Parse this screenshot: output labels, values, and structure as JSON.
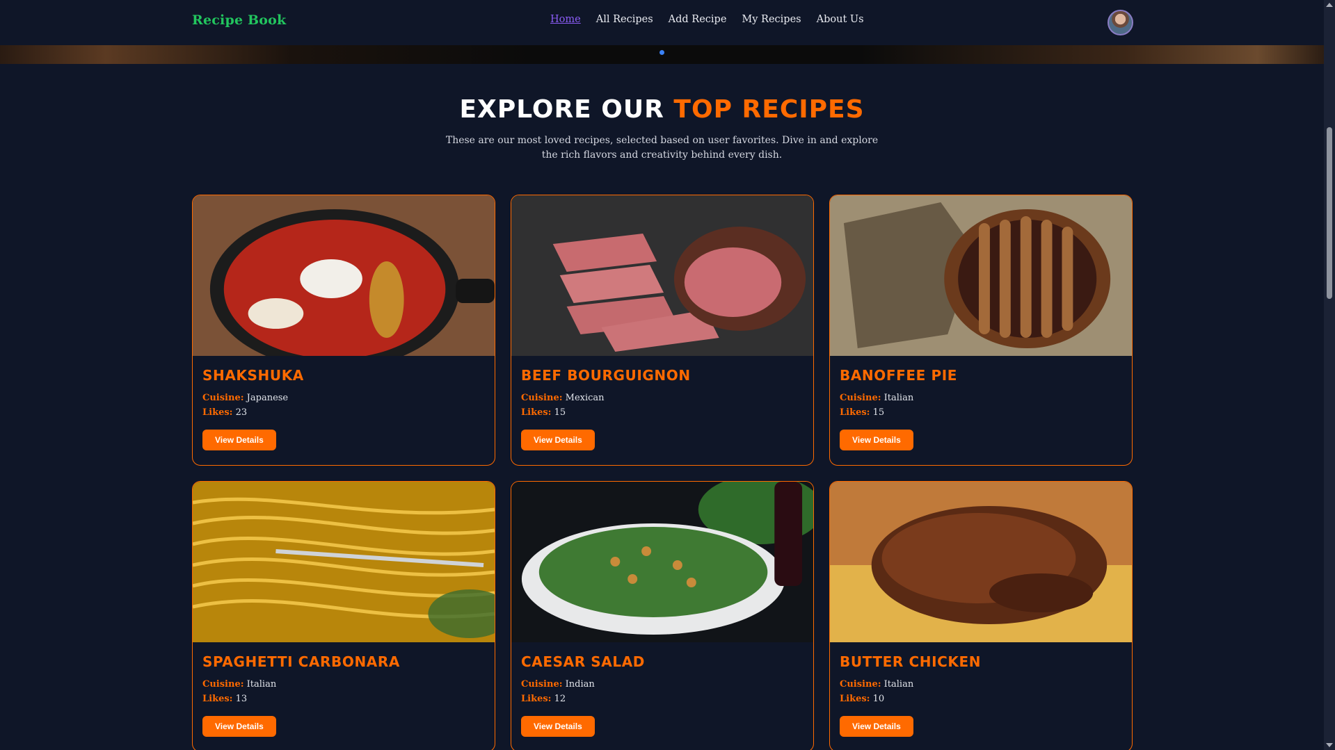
{
  "header": {
    "brand": "Recipe Book",
    "nav": [
      {
        "label": "Home",
        "active": true
      },
      {
        "label": "All Recipes",
        "active": false
      },
      {
        "label": "Add Recipe",
        "active": false
      },
      {
        "label": "My Recipes",
        "active": false
      },
      {
        "label": "About Us",
        "active": false
      }
    ]
  },
  "hero": {
    "active_slide_indicator": "dot"
  },
  "section": {
    "title_plain": "Explore Our",
    "title_accent": "Top Recipes",
    "subtitle": "These are our most loved recipes, selected based on user favorites. Dive in and explore the rich flavors and creativity behind every dish."
  },
  "recipes": [
    {
      "name": "Shakshuka",
      "cuisine_label": "Cuisine:",
      "cuisine": "Japanese",
      "likes_label": "Likes:",
      "likes": "23",
      "button": "View Details"
    },
    {
      "name": "Beef Bourguignon",
      "cuisine_label": "Cuisine:",
      "cuisine": "Mexican",
      "likes_label": "Likes:",
      "likes": "15",
      "button": "View Details"
    },
    {
      "name": "Banoffee Pie",
      "cuisine_label": "Cuisine:",
      "cuisine": "Italian",
      "likes_label": "Likes:",
      "likes": "15",
      "button": "View Details"
    },
    {
      "name": "Spaghetti Carbonara",
      "cuisine_label": "Cuisine:",
      "cuisine": "Italian",
      "likes_label": "Likes:",
      "likes": "13",
      "button": "View Details"
    },
    {
      "name": "Caesar Salad",
      "cuisine_label": "Cuisine:",
      "cuisine": "Indian",
      "likes_label": "Likes:",
      "likes": "12",
      "button": "View Details"
    },
    {
      "name": "Butter Chicken",
      "cuisine_label": "Cuisine:",
      "cuisine": "Italian",
      "likes_label": "Likes:",
      "likes": "10",
      "button": "View Details"
    }
  ],
  "colors": {
    "background": "#0f1628",
    "accent": "#ff6a00",
    "brand": "#22c55e",
    "active_nav": "#8b5cf6",
    "indicator": "#3b82f6"
  }
}
